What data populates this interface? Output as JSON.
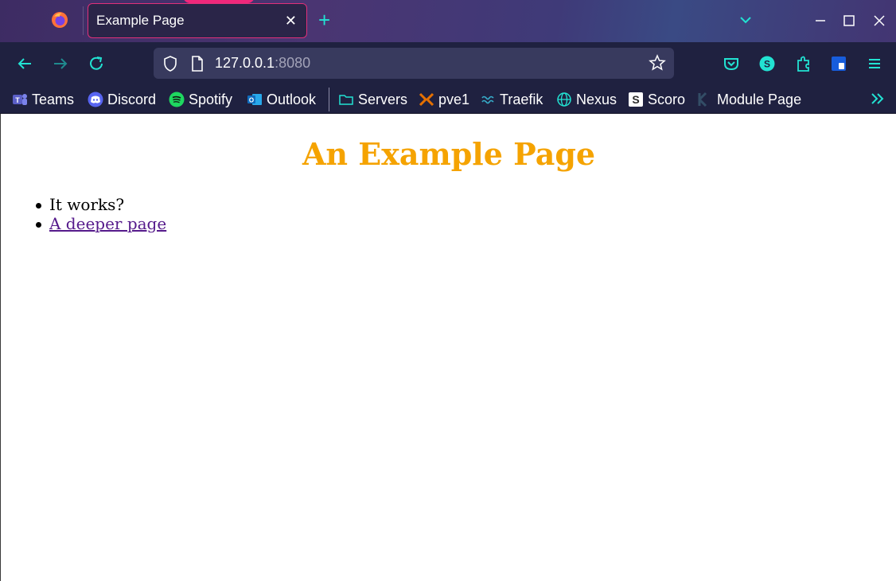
{
  "browser": {
    "tab": {
      "title": "Example Page",
      "close_glyph": "✕",
      "new_tab_glyph": "+"
    },
    "url": {
      "host": "127.0.0.1",
      "port": ":8080"
    },
    "colors": {
      "accent": "#22e2d2",
      "tab_border": "#e0307a",
      "toolbar_bg": "#1f2140"
    }
  },
  "bookmarks": [
    {
      "label": "Teams",
      "icon": "teams-icon"
    },
    {
      "label": "Discord",
      "icon": "discord-icon"
    },
    {
      "label": "Spotify",
      "icon": "spotify-icon"
    },
    {
      "label": "Outlook",
      "icon": "outlook-icon"
    },
    {
      "label": "Servers",
      "icon": "folder-icon"
    },
    {
      "label": "pve1",
      "icon": "proxmox-icon"
    },
    {
      "label": "Traefik",
      "icon": "traefik-icon"
    },
    {
      "label": "Nexus",
      "icon": "globe-icon"
    },
    {
      "label": "Scoro",
      "icon": "scoro-icon"
    },
    {
      "label": "Module Page",
      "icon": "module-icon"
    }
  ],
  "page": {
    "title": "An Example Page",
    "title_color": "#f5a300",
    "items": [
      {
        "text": "It works?",
        "link": false
      },
      {
        "text": "A deeper page",
        "link": true
      }
    ]
  }
}
